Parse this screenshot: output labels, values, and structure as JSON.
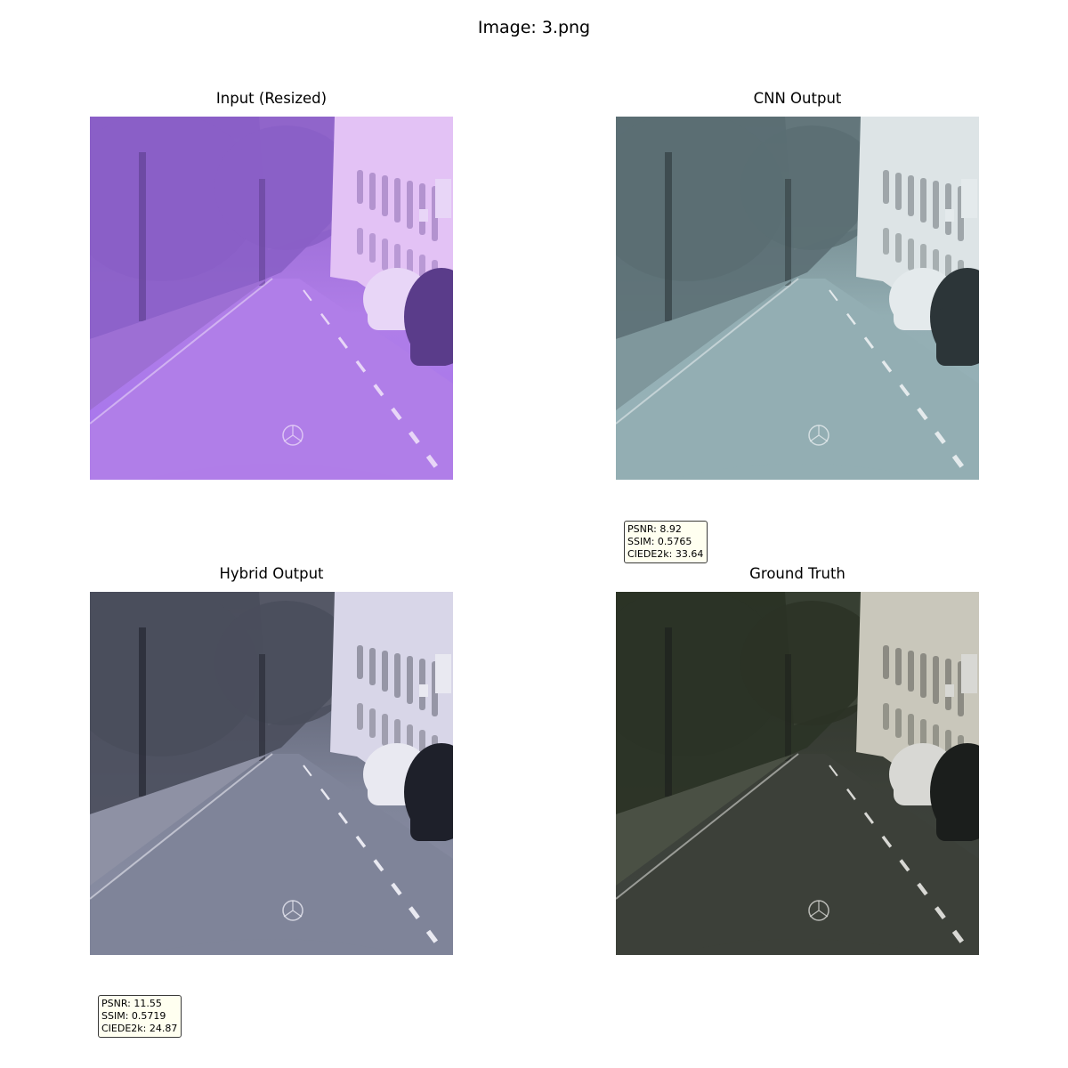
{
  "figure": {
    "title": "Image: 3.png"
  },
  "panels": [
    {
      "title": "Input (Resized)",
      "palette": {
        "sky": "#d9a6f2",
        "foliage": "#8a5fc7",
        "building": "#e3c2f5",
        "road": "#b07ee8",
        "sidewalk": "#9d6fd4",
        "car_light": "#e8d6f7",
        "car_dark": "#5a3c8a",
        "tint": "#a574ee"
      }
    },
    {
      "title": "CNN Output",
      "palette": {
        "sky": "#c9d6da",
        "foliage": "#5b6e73",
        "building": "#dde4e6",
        "road": "#93aeb3",
        "sidewalk": "#7f979c",
        "car_light": "#e4eaec",
        "car_dark": "#2c3538",
        "tint": "#98b4ba"
      }
    },
    {
      "title": "Hybrid Output",
      "palette": {
        "sky": "#d6d9e6",
        "foliage": "#4a4e5c",
        "building": "#d8d6e8",
        "road": "#7f8499",
        "sidewalk": "#8e91a4",
        "car_light": "#e9e9f1",
        "car_dark": "#1e202a",
        "tint": "#8c90a6"
      }
    },
    {
      "title": "Ground Truth",
      "palette": {
        "sky": "#cfd1c8",
        "foliage": "#2b3326",
        "building": "#c9c7bb",
        "road": "#3c4039",
        "sidewalk": "#4a5044",
        "car_light": "#d8d8d4",
        "car_dark": "#1b1e1c",
        "tint": "#3f4540"
      }
    }
  ],
  "metrics": {
    "cnn": {
      "psnr": "PSNR: 8.92",
      "ssim": "SSIM: 0.5765",
      "ciede": "CIEDE2k: 33.64"
    },
    "hybrid": {
      "psnr": "PSNR: 11.55",
      "ssim": "SSIM: 0.5719",
      "ciede": "CIEDE2k: 24.87"
    }
  }
}
